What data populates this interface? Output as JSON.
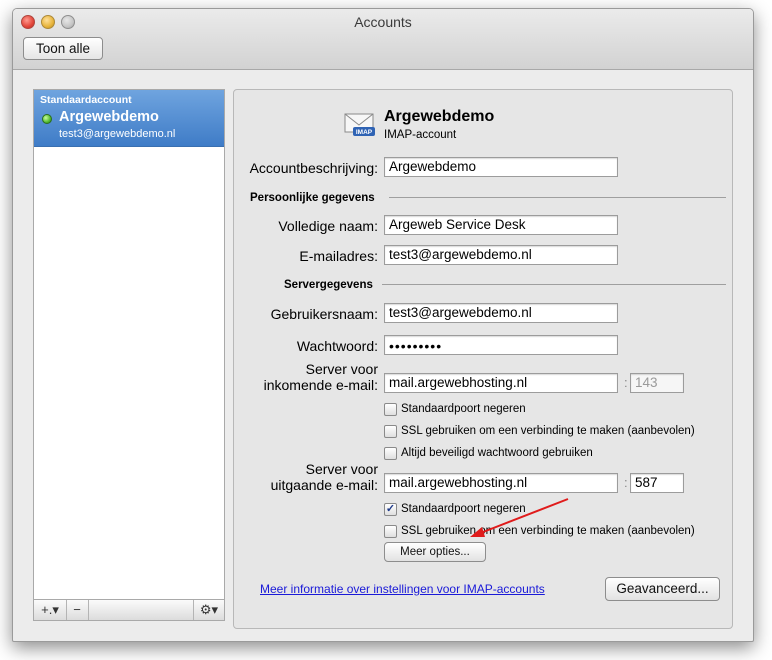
{
  "window": {
    "title": "Accounts",
    "show_all_label": "Toon alle"
  },
  "sidebar": {
    "account": {
      "header": "Standaardaccount",
      "name": "Argewebdemo",
      "email": "test3@argewebdemo.nl",
      "status_icon": "online-status-icon"
    },
    "buttons": {
      "add_label": "+.▾",
      "remove_label": "−",
      "gear_label": "⚙▾"
    }
  },
  "account": {
    "title": "Argewebdemo",
    "type": "IMAP-account",
    "icon": "imap-mail-icon",
    "description_label": "Accountbeschrijving:",
    "description_value": "Argewebdemo"
  },
  "personal": {
    "section_title": "Persoonlijke gegevens",
    "fullname_label": "Volledige naam:",
    "fullname_value": "Argeweb Service Desk",
    "email_label": "E-mailadres:",
    "email_value": "test3@argewebdemo.nl"
  },
  "server": {
    "section_title": "Servergegevens",
    "username_label": "Gebruikersnaam:",
    "username_value": "test3@argewebdemo.nl",
    "password_label": "Wachtwoord:",
    "password_value": "•••••••••",
    "incoming": {
      "label_line1": "Server voor",
      "label_line2": "inkomende e-mail:",
      "host": "mail.argewebhosting.nl",
      "port": "143",
      "options": [
        {
          "label": "Standaardpoort negeren",
          "checked": false
        },
        {
          "label": "SSL gebruiken om een verbinding te maken (aanbevolen)",
          "checked": false
        },
        {
          "label": "Altijd beveiligd wachtwoord gebruiken",
          "checked": false
        }
      ]
    },
    "outgoing": {
      "label_line1": "Server voor",
      "label_line2": "uitgaande e-mail:",
      "host": "mail.argewebhosting.nl",
      "port": "587",
      "options": [
        {
          "label": "Standaardpoort negeren",
          "checked": true
        },
        {
          "label": "SSL gebruiken om een verbinding te maken (aanbevolen)",
          "checked": false
        }
      ]
    },
    "more_options_label": "Meer opties..."
  },
  "footer": {
    "info_link": "Meer informatie over instellingen voor IMAP-accounts",
    "advanced_label": "Geavanceerd..."
  },
  "colors": {
    "selection": "#4a86cf",
    "link": "#1a1ad8",
    "annotation_arrow": "#e01b1b"
  }
}
